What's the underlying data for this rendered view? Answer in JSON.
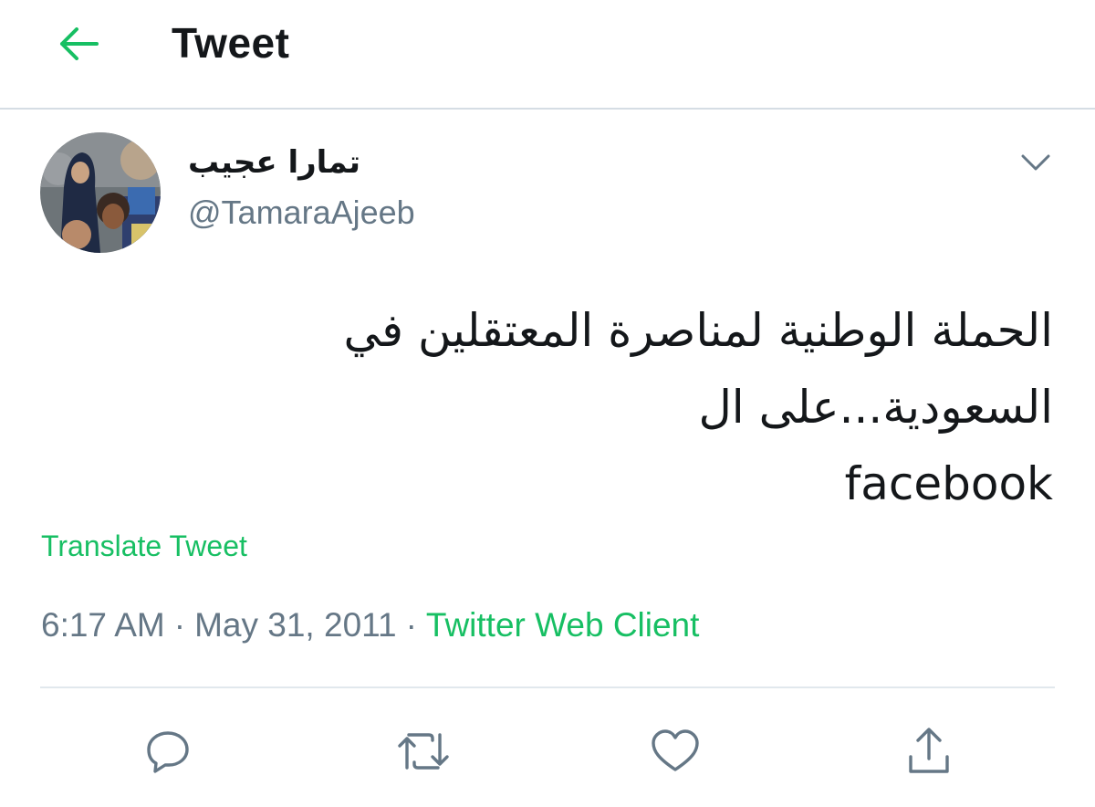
{
  "colors": {
    "accent": "#17bf63",
    "text": "#14171a",
    "secondary": "#657786",
    "divider": "#e1e8ed"
  },
  "header": {
    "back_icon": "arrow-left-icon",
    "title": "Tweet"
  },
  "tweet": {
    "author": {
      "display_name": "تمارا عجيب",
      "handle": "@TamaraAjeeb",
      "avatar": "profile-photo"
    },
    "menu_icon": "chevron-down-icon",
    "text_lines": [
      "الحملة الوطنية لمناصرة المعتقلين في",
      "السعودية...على ال",
      "facebook"
    ],
    "translate_label": "Translate Tweet",
    "time": "6:17 AM",
    "separator": "·",
    "date": "May 31, 2011",
    "client": "Twitter Web Client"
  },
  "actions": [
    {
      "name": "reply",
      "icon": "reply-icon"
    },
    {
      "name": "retweet",
      "icon": "retweet-icon"
    },
    {
      "name": "like",
      "icon": "heart-icon"
    },
    {
      "name": "share",
      "icon": "share-icon"
    }
  ]
}
